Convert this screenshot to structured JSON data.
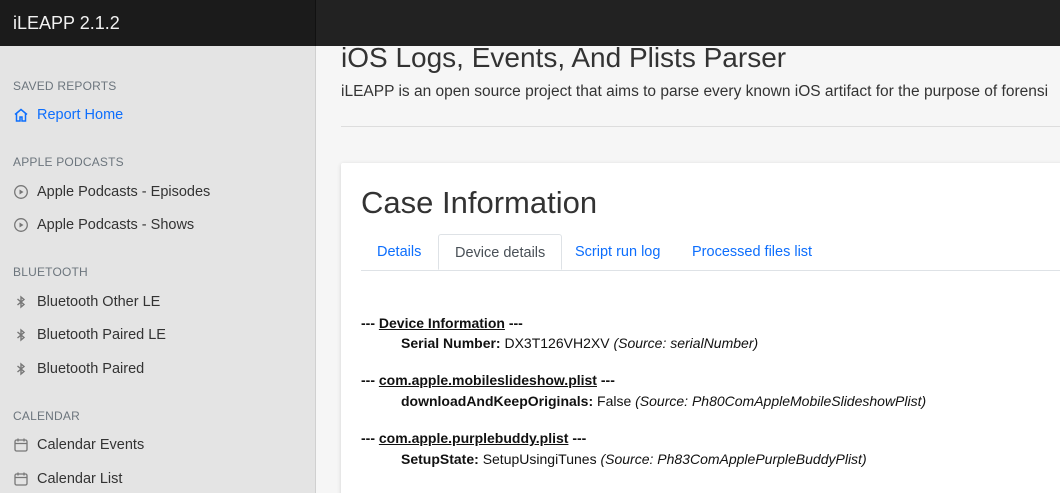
{
  "app": {
    "title": "iLEAPP 2.1.2"
  },
  "sidebar": {
    "groups": [
      {
        "heading": "SAVED REPORTS",
        "items": [
          {
            "label": "Report Home",
            "icon": "home-icon",
            "active": true
          }
        ]
      },
      {
        "heading": "APPLE PODCASTS",
        "items": [
          {
            "label": "Apple Podcasts - Episodes",
            "icon": "play-circle-icon"
          },
          {
            "label": "Apple Podcasts - Shows",
            "icon": "play-circle-icon"
          }
        ]
      },
      {
        "heading": "BLUETOOTH",
        "items": [
          {
            "label": "Bluetooth Other LE",
            "icon": "bluetooth-icon"
          },
          {
            "label": "Bluetooth Paired LE",
            "icon": "bluetooth-icon"
          },
          {
            "label": "Bluetooth Paired",
            "icon": "bluetooth-icon"
          }
        ]
      },
      {
        "heading": "CALENDAR",
        "items": [
          {
            "label": "Calendar Events",
            "icon": "calendar-icon"
          },
          {
            "label": "Calendar List",
            "icon": "calendar-icon"
          }
        ]
      }
    ]
  },
  "main": {
    "title": "iOS Logs, Events, And Plists Parser",
    "description": "iLEAPP is an open source project that aims to parse every known iOS artifact for the purpose of forensi",
    "card": {
      "title": "Case Information",
      "tabs": [
        {
          "label": "Details"
        },
        {
          "label": "Device details",
          "active": true
        },
        {
          "label": "Script run log"
        },
        {
          "label": "Processed files list"
        }
      ],
      "sections": [
        {
          "prefix": "---",
          "name": "Device Information",
          "suffix": "---",
          "entries": [
            {
              "key": "Serial Number:",
              "value": "DX3T126VH2XV",
              "source": "(Source: serialNumber)"
            }
          ]
        },
        {
          "prefix": "---",
          "name": "com.apple.mobileslideshow.plist",
          "suffix": "---",
          "entries": [
            {
              "key": "downloadAndKeepOriginals:",
              "value": "False",
              "source": "(Source: Ph80ComAppleMobileSlideshowPlist)"
            }
          ]
        },
        {
          "prefix": "---",
          "name": "com.apple.purplebuddy.plist",
          "suffix": "---",
          "entries": [
            {
              "key": "SetupState:",
              "value": "SetupUsingiTunes",
              "source": "(Source: Ph83ComApplePurpleBuddyPlist)"
            }
          ]
        }
      ]
    }
  },
  "colors": {
    "accent": "#0d6efd",
    "topbar": "#222222",
    "sidebar_bg": "#e4e4e4"
  }
}
